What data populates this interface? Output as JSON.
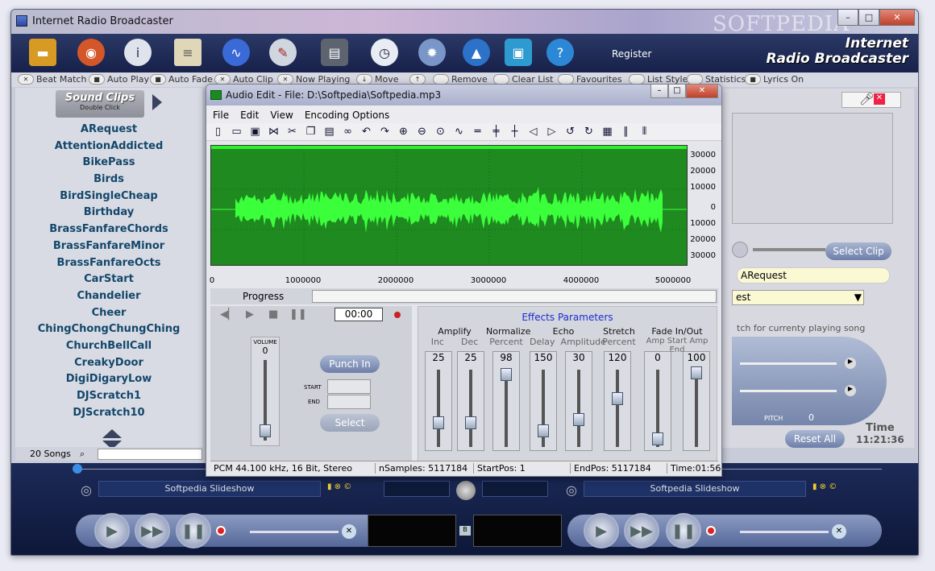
{
  "window": {
    "title": "Internet Radio Broadcaster",
    "watermark": "SOFTPEDIA"
  },
  "brand": {
    "line1": "Internet",
    "line2": "Radio Broadcaster"
  },
  "toolbar": {
    "register_label": "Register"
  },
  "options": [
    "Beat Match",
    "Auto Play",
    "Auto Fade",
    "Auto Clip",
    "Now Playing",
    "Move",
    "Remove",
    "Clear List",
    "Favourites",
    "List Style",
    "Statistics",
    "Lyrics On"
  ],
  "sound_clips": {
    "header": "Sound Clips",
    "subheader": "Double Click",
    "items": [
      "ARequest",
      "AttentionAddicted",
      "BikePass",
      "Birds",
      "BirdSingleCheap",
      "Birthday",
      "BrassFanfareChords",
      "BrassFanfareMinor",
      "BrassFanfareOcts",
      "CarStart",
      "Chandelier",
      "Cheer",
      "ChingChongChungChing",
      "ChurchBellCall",
      "CreakyDoor",
      "DigiDigaryLow",
      "DJScratch1",
      "DJScratch10"
    ],
    "count": "20 Songs"
  },
  "right_panel": {
    "select_clip": "Select Clip",
    "request": "ARequest",
    "dropdown": "est",
    "pitch_hint": "tch for currenty playing song",
    "pitch_label": "PITCH",
    "pitch_value": "0",
    "reset_all": "Reset All",
    "time_label": "Time",
    "time_value": "11:21:36"
  },
  "audio_edit": {
    "title": "Audio Edit - File: D:\\Softpedia\\Softpedia.mp3",
    "menu": [
      "File",
      "Edit",
      "View",
      "Encoding Options"
    ],
    "y_ticks": [
      "30000",
      "20000",
      "10000",
      "0",
      "10000",
      "20000",
      "30000"
    ],
    "x_ticks": [
      "0",
      "1000000",
      "2000000",
      "3000000",
      "4000000",
      "5000000"
    ],
    "progress_label": "Progress",
    "time": "00:00",
    "volume_label": "VOLUME",
    "volume_value": "0",
    "punch_in": "Punch In",
    "start_label": "START",
    "end_label": "END",
    "select": "Select",
    "effects_header": "Effects Parameters",
    "effects": [
      {
        "group": "Amplify",
        "subs": [
          "Inc",
          "Dec"
        ],
        "values": [
          "25",
          "25"
        ]
      },
      {
        "group": "Normalize",
        "subs": [
          "Percent"
        ],
        "values": [
          "98"
        ]
      },
      {
        "group": "Echo",
        "subs": [
          "Delay",
          "Amplitude"
        ],
        "values": [
          "150",
          "30"
        ]
      },
      {
        "group": "Stretch",
        "subs": [
          "Percent"
        ],
        "values": [
          "120"
        ]
      },
      {
        "group": "Fade In/Out",
        "subs": [
          "Amp Start",
          "Amp End"
        ],
        "values": [
          "0",
          "100"
        ]
      }
    ],
    "status": [
      "PCM 44.100 kHz, 16 Bit, Stereo",
      "nSamples: 5117184",
      "StartPos: 1",
      "EndPos: 5117184",
      "Time:01:56"
    ]
  },
  "decks": {
    "left_title": "Softpedia Slideshow",
    "right_title": "Softpedia Slideshow",
    "mid_label": "B"
  }
}
